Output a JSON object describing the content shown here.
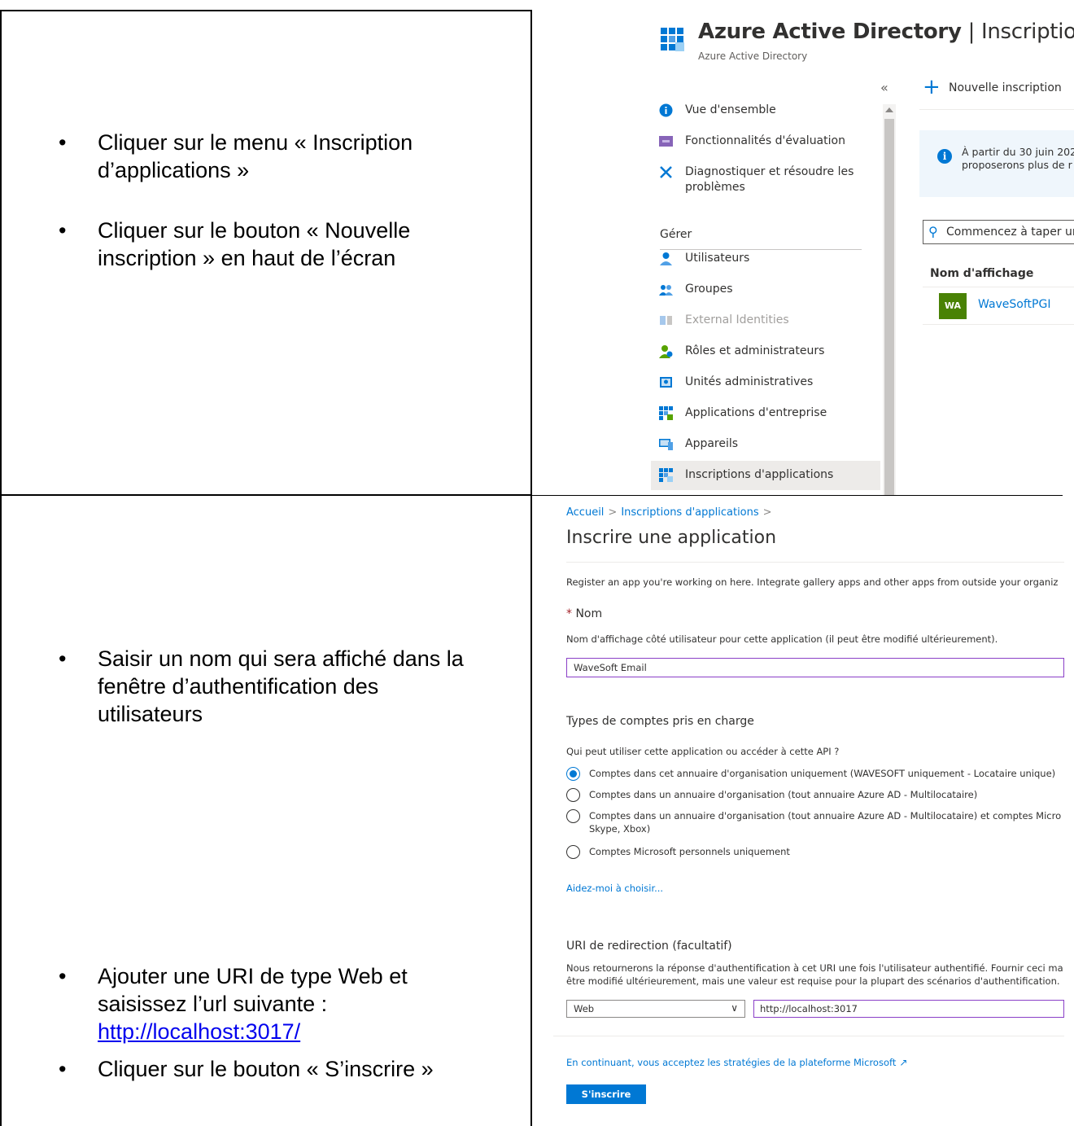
{
  "instructions": {
    "row1": [
      {
        "lines": [
          "Cliquer sur le menu « Inscription",
          "d’applications »"
        ]
      },
      {
        "lines": [
          "Cliquer sur le bouton « Nouvelle",
          "inscription » en haut de l’écran"
        ]
      }
    ],
    "row2": [
      {
        "lines": [
          "Saisir un nom qui sera affiché dans la",
          "fenêtre d’authentification des",
          "utilisateurs"
        ]
      },
      {
        "lines": [
          "Ajouter une URI de type Web et",
          "saisissez l’url suivante :"
        ],
        "link": "http://localhost:3017/"
      },
      {
        "lines": [
          "Cliquer sur le bouton « S’inscrire »"
        ]
      }
    ]
  },
  "azure": {
    "title_bold": "Azure Active Directory",
    "title_sep": " | ",
    "title_rest": "Inscriptions",
    "subtitle": "Azure Active Directory",
    "collapse_glyph": "«",
    "nav": [
      {
        "label": "Vue d'ensemble",
        "icon": "info-icon"
      },
      {
        "label": "Fonctionnalités d'évaluation",
        "icon": "preview-features-icon"
      },
      {
        "label": "Diagnostiquer et résoudre les",
        "label2": "problèmes",
        "icon": "wrench-icon"
      }
    ],
    "section": "Gérer",
    "manage": [
      {
        "label": "Utilisateurs",
        "icon": "user-icon"
      },
      {
        "label": "Groupes",
        "icon": "groups-icon"
      },
      {
        "label": "External Identities",
        "icon": "external-identities-icon",
        "disabled": true
      },
      {
        "label": "Rôles et administrateurs",
        "icon": "roles-icon"
      },
      {
        "label": "Unités administratives",
        "icon": "admin-units-icon"
      },
      {
        "label": "Applications d'entreprise",
        "icon": "enterprise-apps-icon"
      },
      {
        "label": "Appareils",
        "icon": "devices-icon"
      },
      {
        "label": "Inscriptions d'applications",
        "icon": "app-registrations-icon",
        "selected": true
      }
    ],
    "new_registration": "Nouvelle inscription",
    "info_line1": "À partir du 30 juin 202",
    "info_line2": "proposerons plus de r",
    "search_placeholder": "Commencez à taper ur",
    "column_header": "Nom d'affichage",
    "app_initials": "WA",
    "app_name": "WaveSoftPGI",
    "colors": {
      "accent": "#0078d4",
      "avatar": "#498205"
    }
  },
  "register": {
    "breadcrumb": [
      "Accueil",
      "Inscriptions d'applications"
    ],
    "title": "Inscrire une application",
    "intro": "Register an app you're working on here. Integrate gallery apps and other apps from outside your organiz",
    "name_required": "*",
    "name_label": "Nom",
    "name_help": "Nom d'affichage côté utilisateur pour cette application (il peut être modifié ultérieurement).",
    "name_value": "WaveSoft Email",
    "account_types_title": "Types de comptes pris en charge",
    "account_question": "Qui peut utiliser cette application ou accéder à cette API ?",
    "account_options": [
      {
        "label": "Comptes dans cet annuaire d'organisation uniquement (WAVESOFT uniquement - Locataire unique)",
        "checked": true
      },
      {
        "label": "Comptes dans un annuaire d'organisation (tout annuaire Azure AD - Multilocataire)",
        "checked": false
      },
      {
        "label": "Comptes dans un annuaire d'organisation (tout annuaire Azure AD - Multilocataire) et comptes Micro",
        "label2": "Skype, Xbox)",
        "checked": false
      },
      {
        "label": "Comptes Microsoft personnels uniquement",
        "checked": false
      }
    ],
    "help_choose": "Aidez-moi à choisir...",
    "redirect_title": "URI de redirection (facultatif)",
    "redirect_help1": "Nous retournerons la réponse d'authentification à cet URI une fois l'utilisateur authentifié. Fournir ceci ma",
    "redirect_help2": "être modifié ultérieurement, mais une valeur est requise pour la plupart des scénarios d'authentification.",
    "platform_value": "Web",
    "uri_value": "http://localhost:3017",
    "policy_link": "En continuant, vous acceptez les stratégies de la plateforme Microsoft",
    "submit_label": "S'inscrire"
  }
}
